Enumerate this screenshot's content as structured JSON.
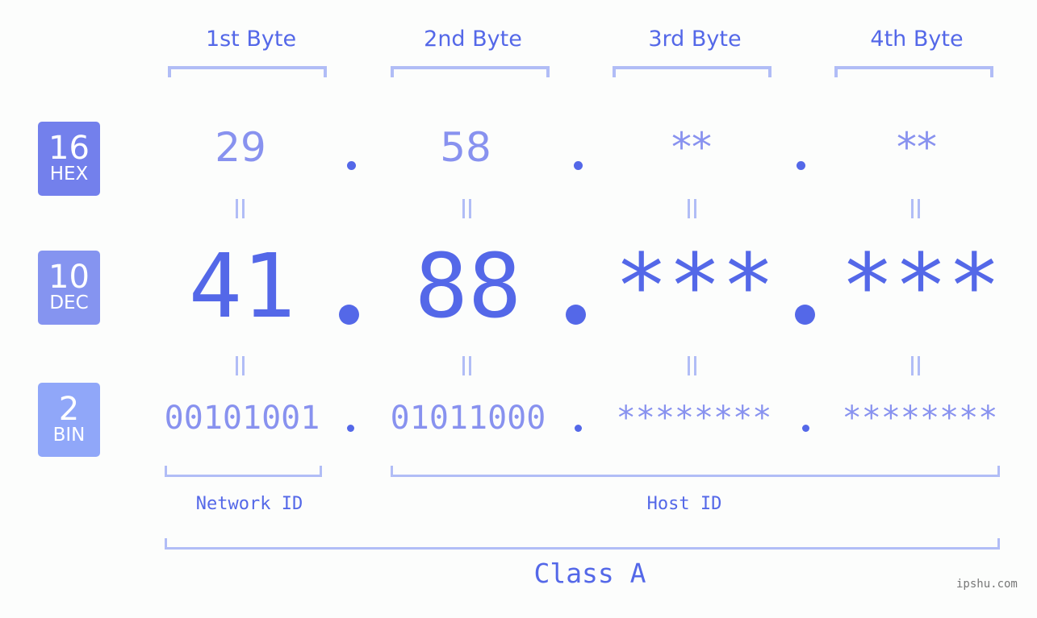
{
  "byte_headers": [
    "1st Byte",
    "2nd Byte",
    "3rd Byte",
    "4th Byte"
  ],
  "badges": [
    {
      "num": "16",
      "label": "HEX",
      "color": "#7380ec"
    },
    {
      "num": "10",
      "label": "DEC",
      "color": "#8594f0"
    },
    {
      "num": "2",
      "label": "BIN",
      "color": "#90a7f9"
    }
  ],
  "hex": [
    "29",
    "58",
    "**",
    "**"
  ],
  "dec": [
    "41",
    "88",
    "***",
    "***"
  ],
  "bin": [
    "00101001",
    "01011000",
    "********",
    "********"
  ],
  "network_label": "Network ID",
  "host_label": "Host ID",
  "class_label": "Class A",
  "watermark": "ipshu.com",
  "colors": {
    "accent": "#5468e8",
    "light": "#8892ef",
    "bracket": "#b1bdf6"
  }
}
